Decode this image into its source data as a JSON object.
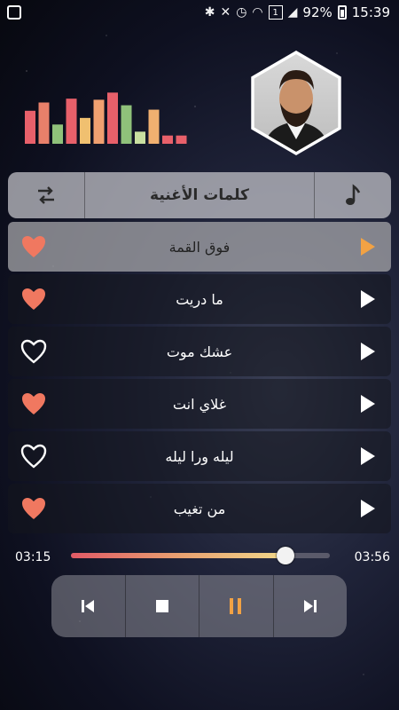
{
  "statusbar": {
    "battery": "92%",
    "time": "15:39",
    "sim_badge": "1"
  },
  "equalizer": {
    "levels": [
      0.6,
      0.75,
      0.35,
      0.82,
      0.47,
      0.8,
      0.93,
      0.7,
      0.22,
      0.62,
      0.15,
      0.15
    ],
    "colors": [
      "#e8606a",
      "#e8806a",
      "#8fc17a",
      "#e8606a",
      "#f0c070",
      "#f0a070",
      "#e8606a",
      "#8fc17a",
      "#c9e0a0",
      "#f0b070",
      "#e8606a",
      "#e8606a"
    ]
  },
  "header": {
    "title": "كلمات الأغنية",
    "left_icon": "shuffle-icon",
    "right_icon": "music-note-icon"
  },
  "songs": [
    {
      "title": "فوق القمة",
      "liked": true,
      "active": true
    },
    {
      "title": "ما دريت",
      "liked": true,
      "active": false
    },
    {
      "title": "عشك موت",
      "liked": false,
      "active": false
    },
    {
      "title": "غلاي انت",
      "liked": true,
      "active": false
    },
    {
      "title": "ليله ورا ليله",
      "liked": false,
      "active": false
    },
    {
      "title": "من تغيب",
      "liked": true,
      "active": false
    }
  ],
  "player": {
    "current_time": "03:15",
    "total_time": "03:56",
    "progress": 0.83
  },
  "colors": {
    "accent": "#f2a244",
    "heart": "#f07860"
  },
  "controls": [
    "previous-icon",
    "stop-icon",
    "pause-icon",
    "next-icon"
  ]
}
